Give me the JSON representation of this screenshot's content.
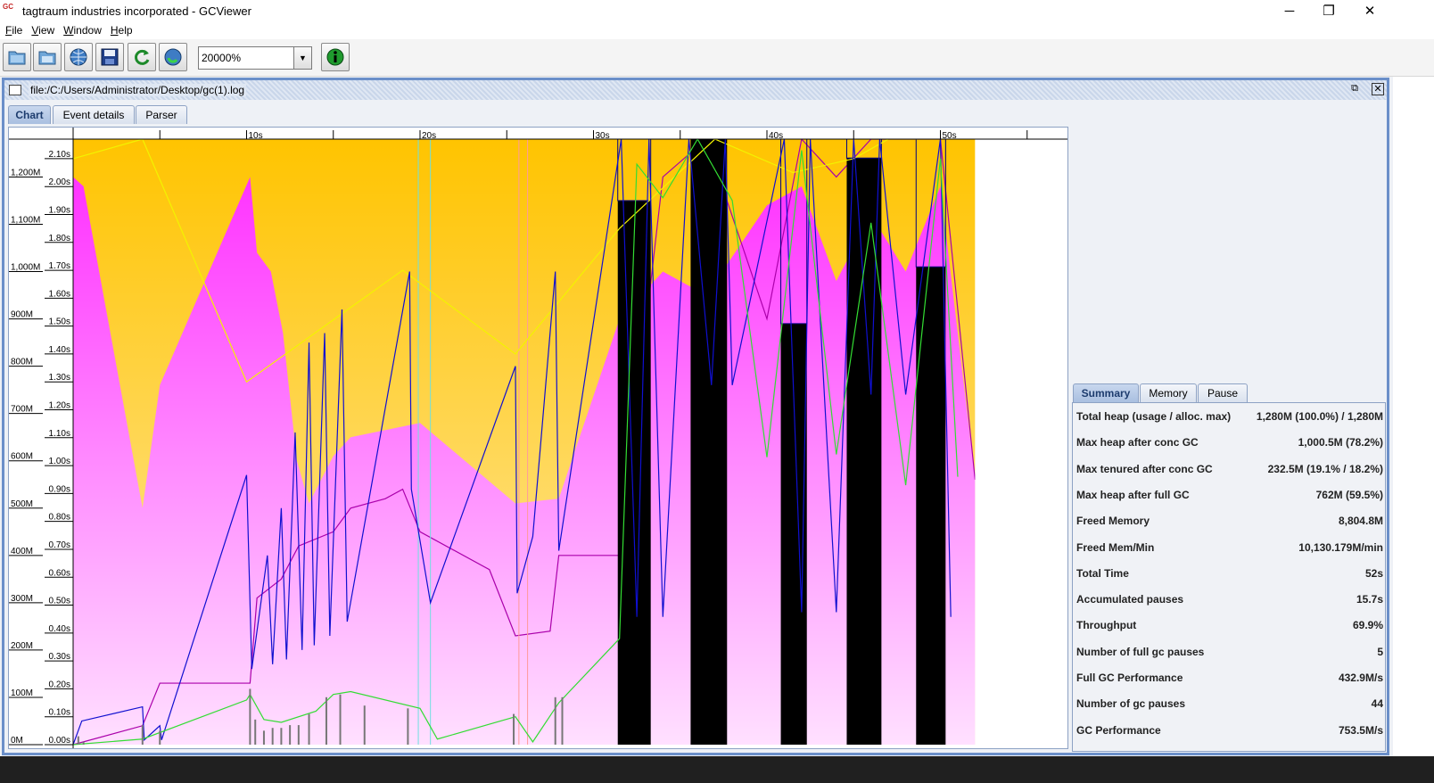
{
  "window": {
    "title": "tagtraum industries incorporated - GCViewer",
    "icon_text": "GC",
    "controls": {
      "minimize": "─",
      "maximize": "❐",
      "close": "✕"
    }
  },
  "menu": [
    {
      "label": "File",
      "underline": "F",
      "rest": "ile"
    },
    {
      "label": "View",
      "underline": "V",
      "rest": "iew"
    },
    {
      "label": "Window",
      "underline": "W",
      "rest": "indow"
    },
    {
      "label": "Help",
      "underline": "H",
      "rest": "elp"
    }
  ],
  "toolbar": {
    "buttons": [
      "open-file-icon",
      "open-recent-icon",
      "open-url-icon",
      "export-icon",
      "refresh-icon",
      "watch-icon"
    ],
    "zoom_value": "20000%",
    "info_icon": "info-icon"
  },
  "document": {
    "title": "file:/C:/Users/Administrator/Desktop/gc(1).log",
    "tabs": [
      {
        "label": "Chart",
        "active": true
      },
      {
        "label": "Event details",
        "active": false
      },
      {
        "label": "Parser",
        "active": false
      }
    ]
  },
  "summary": {
    "tabs": [
      {
        "label": "Summary",
        "active": true
      },
      {
        "label": "Memory",
        "active": false
      },
      {
        "label": "Pause",
        "active": false
      }
    ],
    "rows": [
      {
        "label": "Total heap (usage / alloc. max)",
        "value": "1,280M (100.0%) / 1,280M"
      },
      {
        "label": "Max heap after conc GC",
        "value": "1,000.5M (78.2%)"
      },
      {
        "label": "Max tenured after conc GC",
        "value": "232.5M (19.1% / 18.2%)"
      },
      {
        "label": "Max heap after full GC",
        "value": "762M (59.5%)"
      },
      {
        "label": "Freed Memory",
        "value": "8,804.8M"
      },
      {
        "label": "Freed Mem/Min",
        "value": "10,130.179M/min"
      },
      {
        "label": "Total Time",
        "value": "52s"
      },
      {
        "label": "Accumulated pauses",
        "value": "15.7s"
      },
      {
        "label": "Throughput",
        "value": "69.9%"
      },
      {
        "label": "Number of full gc pauses",
        "value": "5"
      },
      {
        "label": "Full GC Performance",
        "value": "432.9M/s"
      },
      {
        "label": "Number of gc pauses",
        "value": "44"
      },
      {
        "label": "GC Performance",
        "value": "753.5M/s"
      }
    ]
  },
  "chart_data": {
    "type": "area",
    "x_ticks": [
      "10s",
      "20s",
      "30s",
      "40s",
      "50s"
    ],
    "x_tick_values": [
      10,
      20,
      30,
      40,
      50
    ],
    "xlim": [
      0,
      57
    ],
    "memory_axis": {
      "labels": [
        "0M",
        "100M",
        "200M",
        "300M",
        "400M",
        "500M",
        "600M",
        "700M",
        "800M",
        "900M",
        "1,000M",
        "1,100M",
        "1,200M"
      ],
      "values": [
        0,
        100,
        200,
        300,
        400,
        500,
        600,
        700,
        800,
        900,
        1000,
        1100,
        1200
      ],
      "ylim": [
        0,
        1280
      ]
    },
    "pause_axis": {
      "labels": [
        "0.00s",
        "0.10s",
        "0.20s",
        "0.30s",
        "0.40s",
        "0.50s",
        "0.60s",
        "0.70s",
        "0.80s",
        "0.90s",
        "1.00s",
        "1.10s",
        "1.20s",
        "1.30s",
        "1.40s",
        "1.50s",
        "1.60s",
        "1.70s",
        "1.80s",
        "1.90s",
        "2.00s",
        "2.10s"
      ],
      "values": [
        0,
        0.1,
        0.2,
        0.3,
        0.4,
        0.5,
        0.6,
        0.7,
        0.8,
        0.9,
        1.0,
        1.1,
        1.2,
        1.3,
        1.4,
        1.5,
        1.6,
        1.7,
        1.8,
        1.9,
        2.0,
        2.1
      ],
      "ylim": [
        0,
        2.17
      ]
    },
    "total_heap_end": 52,
    "young_heap": {
      "x": [
        0,
        0.6,
        4,
        5,
        10.2,
        10.6,
        11.4,
        12.1,
        12.9,
        13.6,
        15,
        16,
        20,
        25.5,
        28,
        31.5,
        34,
        36.5,
        40,
        42,
        44,
        46,
        48,
        50,
        52
      ],
      "y": [
        1200,
        1180,
        500,
        760,
        1200,
        1040,
        1000,
        870,
        600,
        510,
        610,
        650,
        680,
        510,
        520,
        900,
        1000,
        950,
        1140,
        1180,
        980,
        1120,
        1000,
        1180,
        560
      ]
    },
    "tenured_heap": {
      "x": [
        0,
        4,
        5,
        10.2,
        10.6,
        12,
        13,
        15,
        16,
        18,
        19,
        20,
        24,
        25.5,
        27.5,
        28,
        31.5,
        34,
        36.5,
        40,
        42,
        44,
        46,
        48,
        50,
        52
      ],
      "y": [
        0,
        40,
        130,
        130,
        310,
        350,
        420,
        450,
        500,
        520,
        540,
        450,
        370,
        230,
        240,
        400,
        400,
        1200,
        1280,
        900,
        1280,
        1200,
        1280,
        1280,
        1280,
        560
      ]
    },
    "full_gc_bars": [
      {
        "x0": 31.4,
        "x1": 33.3,
        "heap_after": 1150
      },
      {
        "x0": 35.6,
        "x1": 37.7,
        "heap_after": 1280
      },
      {
        "x0": 40.8,
        "x1": 42.3,
        "heap_after": 890
      },
      {
        "x0": 44.6,
        "x1": 46.6,
        "heap_after": 1240
      },
      {
        "x0": 48.6,
        "x1": 50.3,
        "heap_after": 1010
      }
    ],
    "used_heap": {
      "x": [
        0,
        0.5,
        4,
        4.1,
        5,
        5.1,
        10,
        10.3,
        11.2,
        11.5,
        12,
        12.3,
        12.8,
        13.2,
        13.6,
        13.9,
        14.5,
        14.8,
        15.5,
        15.8,
        19.4,
        19.5,
        20.6,
        25.5,
        25.6,
        26.5,
        27.8,
        28,
        31.6,
        32.5,
        33.2,
        34,
        35.5,
        36.8,
        37.6,
        38,
        41,
        42,
        42.5,
        44,
        45,
        46,
        46.5,
        48,
        50,
        50.6
      ],
      "y": [
        0,
        50,
        80,
        10,
        40,
        10,
        570,
        160,
        400,
        170,
        500,
        180,
        660,
        200,
        850,
        210,
        870,
        230,
        920,
        260,
        1000,
        540,
        300,
        800,
        320,
        440,
        1000,
        410,
        1280,
        270,
        1280,
        270,
        1280,
        760,
        1280,
        760,
        1280,
        280,
        1280,
        280,
        1280,
        740,
        1280,
        740,
        1280,
        270
      ]
    },
    "gc_pause_x": [
      0.3,
      0.6,
      4,
      5,
      10.2,
      10.5,
      11,
      11.5,
      12,
      12.5,
      13,
      13.6,
      14.6,
      15.4,
      16.8,
      19.3,
      25.4,
      27.8,
      28.2
    ],
    "gc_pause_y": [
      0.03,
      0.01,
      0.07,
      0.05,
      0.2,
      0.09,
      0.05,
      0.06,
      0.06,
      0.07,
      0.07,
      0.11,
      0.17,
      0.18,
      0.14,
      0.13,
      0.11,
      0.17,
      0.17
    ],
    "total_pause_line": {
      "x": [
        0,
        4,
        10,
        10.2,
        11,
        12,
        14,
        15,
        16,
        20,
        21,
        25.5,
        26.5,
        28,
        31.5,
        32.5,
        34,
        36,
        38,
        40,
        42,
        44,
        46,
        48,
        50,
        51
      ],
      "y": [
        0,
        0.02,
        0.16,
        0.18,
        0.09,
        0.08,
        0.12,
        0.18,
        0.19,
        0.13,
        0.02,
        0.1,
        0.01,
        0.15,
        0.38,
        2.08,
        1.96,
        2.17,
        1.95,
        1.03,
        2.13,
        1.04,
        1.87,
        0.93,
        2.1,
        0.96
      ]
    },
    "concurrent_markers": [
      19.9,
      25.7,
      20.6,
      26.2
    ],
    "yellow_line": {
      "x": [
        0,
        4,
        10,
        19,
        25.5,
        31.5,
        37,
        41.5,
        45,
        47,
        50
      ],
      "y": [
        2.1,
        2.17,
        1.3,
        1.7,
        1.4,
        1.85,
        2.17,
        2.05,
        2.1,
        2.17,
        2.17
      ]
    }
  }
}
